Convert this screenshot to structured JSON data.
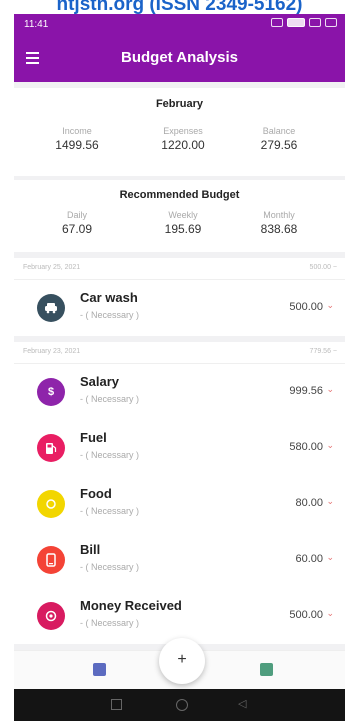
{
  "banner": {
    "text": "ntjstn.org (ISSN 2349-5162)"
  },
  "status_bar": {
    "time": "11:41"
  },
  "app_bar": {
    "title": "Budget Analysis"
  },
  "month_summary": {
    "month": "February",
    "income_label": "Income",
    "income_value": "1499.56",
    "expenses_label": "Expenses",
    "expenses_value": "1220.00",
    "balance_label": "Balance",
    "balance_value": "279.56"
  },
  "recommended": {
    "title": "Recommended Budget",
    "daily_label": "Daily",
    "daily_value": "67.09",
    "weekly_label": "Weekly",
    "weekly_value": "195.69",
    "monthly_label": "Monthly",
    "monthly_value": "838.68"
  },
  "groups": [
    {
      "date": "February 25, 2021",
      "total": "500.00 −",
      "items": [
        {
          "name": "Car wash",
          "tag": "- ( Necessary )",
          "amount": "500.00",
          "icon": "car-icon",
          "color": "#37505f"
        }
      ]
    },
    {
      "date": "February 23, 2021",
      "total": "779.56 −",
      "items": [
        {
          "name": "Salary",
          "tag": "- ( Necessary )",
          "amount": "999.56",
          "icon": "dollar-icon",
          "color": "#8e24aa"
        },
        {
          "name": "Fuel",
          "tag": "- ( Necessary )",
          "amount": "580.00",
          "icon": "fuel-icon",
          "color": "#e91e63"
        },
        {
          "name": "Food",
          "tag": "- ( Necessary )",
          "amount": "80.00",
          "icon": "food-icon",
          "color": "#f2d600"
        },
        {
          "name": "Bill",
          "tag": "- ( Necessary )",
          "amount": "60.00",
          "icon": "bill-icon",
          "color": "#f44336"
        },
        {
          "name": "Money Received",
          "tag": "- ( Necessary )",
          "amount": "500.00",
          "icon": "money-icon",
          "color": "#d81b60"
        }
      ]
    }
  ],
  "fab": {
    "label": "+"
  },
  "colors": {
    "primary": "#8a14a9",
    "expense_chevron": "#e57373"
  }
}
